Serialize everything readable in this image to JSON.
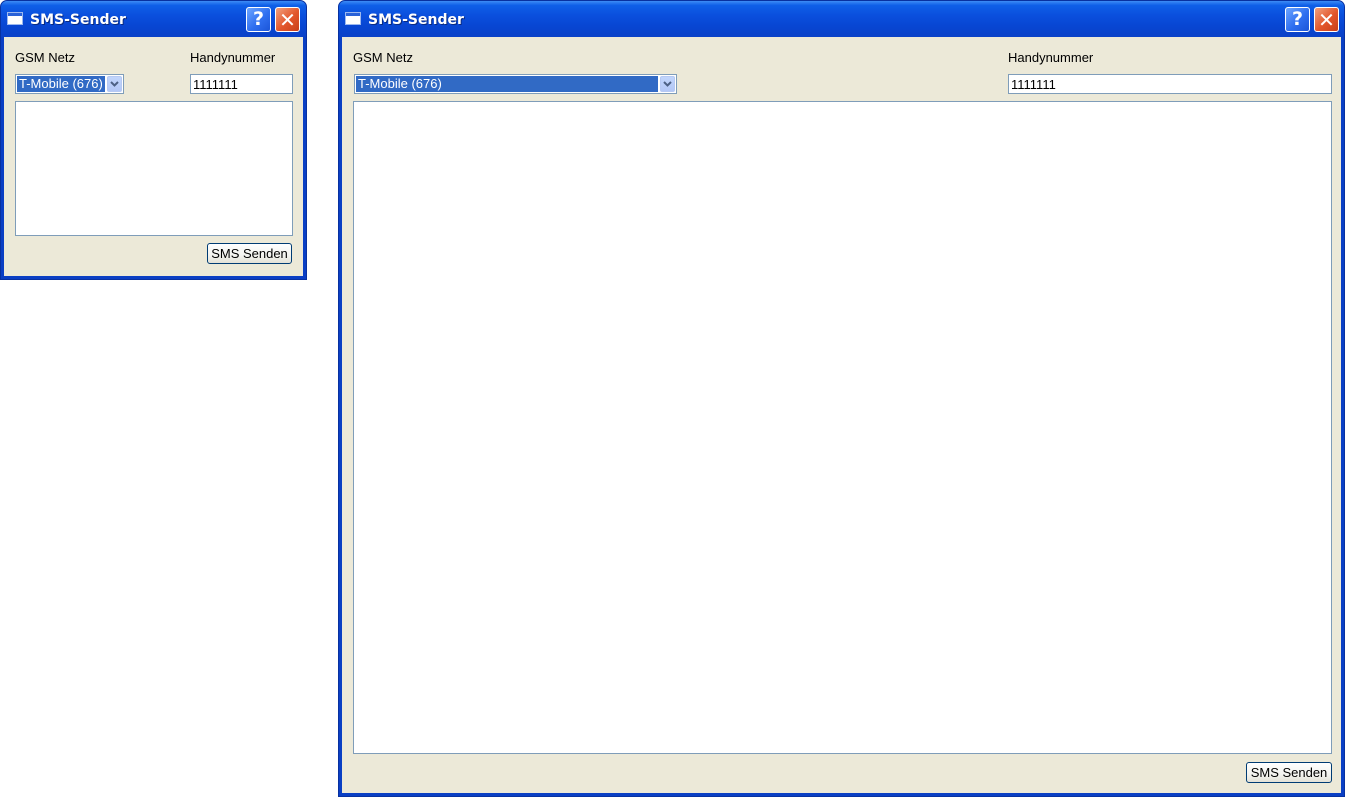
{
  "windows": [
    {
      "title": "SMS-Sender",
      "gsm_label": "GSM Netz",
      "phone_label": "Handynummer",
      "network_selected": "T-Mobile (676)",
      "phone_value": "1111111",
      "message_value": "",
      "send_label": "SMS Senden"
    },
    {
      "title": "SMS-Sender",
      "gsm_label": "GSM Netz",
      "phone_label": "Handynummer",
      "network_selected": "T-Mobile (676)",
      "phone_value": "1111111",
      "message_value": "",
      "send_label": "SMS Senden"
    }
  ],
  "titlebar_icons": {
    "app": "window-icon",
    "help": "help-icon",
    "close": "close-icon",
    "dropdown": "chevron-down-icon"
  },
  "colors": {
    "titlebar": "#0a4fdd",
    "client_background": "#ece9d8",
    "selection": "#316ac5",
    "close_button": "#e2562b",
    "input_border": "#7f9db9"
  }
}
